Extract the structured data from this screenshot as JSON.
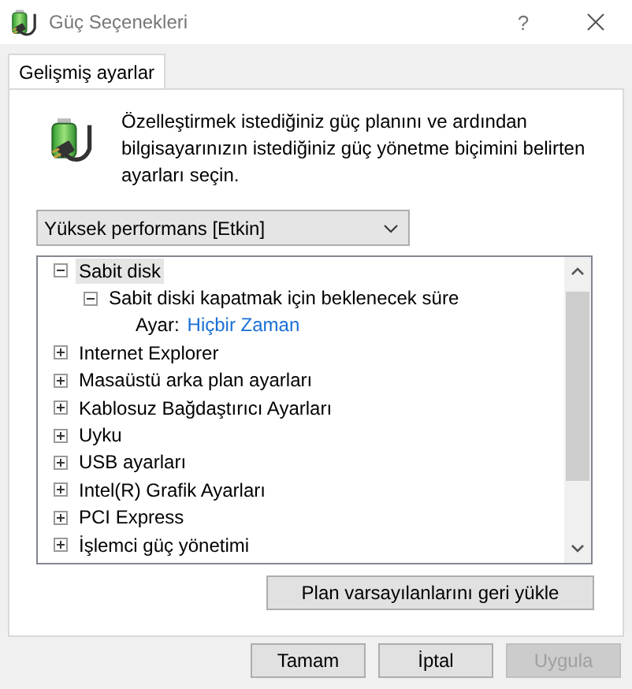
{
  "window": {
    "title": "Güç Seçenekleri",
    "help": "?"
  },
  "tabs": [
    {
      "label": "Gelişmiş ayarlar",
      "selected": true
    }
  ],
  "intro": "Özelleştirmek istediğiniz güç planını ve ardından bilgisayarınızın istediğiniz güç yönetme biçimini belirten ayarları seçin.",
  "plan_dropdown": {
    "value": "Yüksek performans [Etkin]"
  },
  "tree": [
    {
      "kind": "group",
      "label": "Sabit disk",
      "expanded": true,
      "selected": true,
      "children": [
        {
          "kind": "group",
          "label": "Sabit diski kapatmak için beklenecek süre",
          "expanded": true,
          "selected": false,
          "children": [
            {
              "kind": "setting",
              "label": "Ayar:",
              "value": "Hiçbir Zaman"
            }
          ]
        }
      ]
    },
    {
      "kind": "group",
      "label": "Internet Explorer",
      "expanded": false,
      "selected": false
    },
    {
      "kind": "group",
      "label": "Masaüstü arka plan ayarları",
      "expanded": false,
      "selected": false
    },
    {
      "kind": "group",
      "label": "Kablosuz Bağdaştırıcı Ayarları",
      "expanded": false,
      "selected": false
    },
    {
      "kind": "group",
      "label": "Uyku",
      "expanded": false,
      "selected": false
    },
    {
      "kind": "group",
      "label": "USB ayarları",
      "expanded": false,
      "selected": false
    },
    {
      "kind": "group",
      "label": "Intel(R) Grafik Ayarları",
      "expanded": false,
      "selected": false
    },
    {
      "kind": "group",
      "label": "PCI Express",
      "expanded": false,
      "selected": false
    },
    {
      "kind": "group",
      "label": "İşlemci güç yönetimi",
      "expanded": false,
      "selected": false
    }
  ],
  "restore_button": {
    "label": "Plan varsayılanlarını geri yükle"
  },
  "buttons": [
    {
      "label": "Tamam",
      "disabled": false
    },
    {
      "label": "İptal",
      "disabled": false
    },
    {
      "label": "Uygula",
      "disabled": true
    }
  ]
}
